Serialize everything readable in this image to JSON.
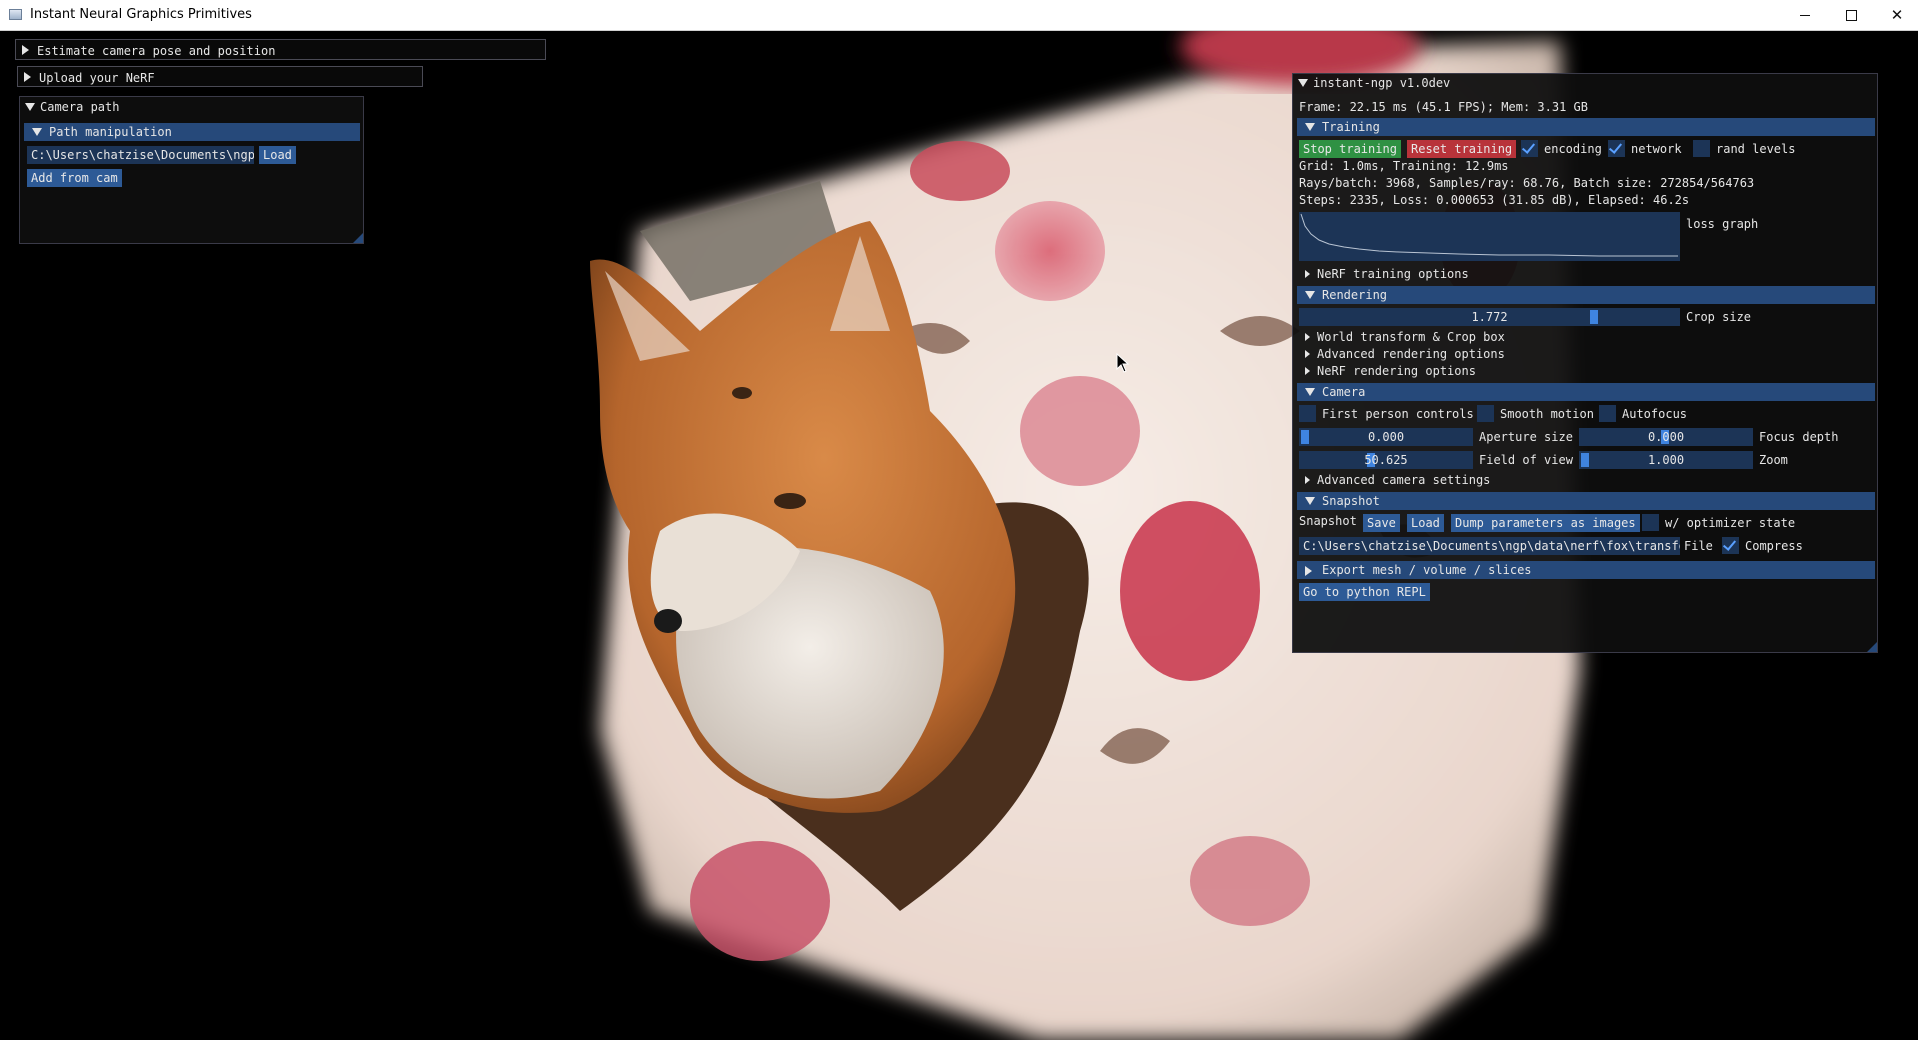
{
  "window": {
    "title": "Instant Neural Graphics Primitives",
    "controls": {
      "minimize": "–",
      "maximize": "□",
      "close": "✕"
    }
  },
  "left_windows": {
    "estimate": {
      "label": "Estimate camera pose and position"
    },
    "upload": {
      "label": "Upload your NeRF"
    },
    "camera_path": {
      "title": "Camera path",
      "path_manipulation": "Path manipulation",
      "path_value": "C:\\Users\\chatzise\\Documents\\ngp\\",
      "load_label": "Load",
      "add_from_cam_label": "Add from cam"
    }
  },
  "main_panel": {
    "title": "instant-ngp v1.0dev",
    "frame_info": "Frame: 22.15 ms (45.1 FPS); Mem: 3.31 GB",
    "training": {
      "header": "Training",
      "stop_label": "Stop training",
      "reset_label": "Reset training",
      "encoding_label": "encoding",
      "encoding_checked": true,
      "network_label": "network",
      "network_checked": true,
      "rand_levels_label": "rand levels",
      "rand_levels_checked": false,
      "grid_info": "Grid: 1.0ms, Training: 12.9ms",
      "rays_info": "Rays/batch: 3968, Samples/ray: 68.76, Batch size: 272854/564763",
      "steps_info": "Steps: 2335, Loss: 0.000653 (31.85 dB), Elapsed: 46.2s",
      "loss_graph_label": "loss graph",
      "options_label": "NeRF training options"
    },
    "rendering": {
      "header": "Rendering",
      "crop_value": "1.772",
      "crop_fraction": 0.77,
      "crop_label": "Crop size",
      "world_transform_label": "World transform & Crop box",
      "advanced_label": "Advanced rendering options",
      "nerf_label": "NeRF rendering options"
    },
    "camera": {
      "header": "Camera",
      "first_person_label": "First person controls",
      "smooth_motion_label": "Smooth motion",
      "autofocus_label": "Autofocus",
      "aperture_value": "0.000",
      "aperture_label": "Aperture size",
      "focus_value": "0.000",
      "focus_label": "Focus depth",
      "fov_value": "50.625",
      "fov_label": "Field of view",
      "zoom_value": "1.000",
      "zoom_label": "Zoom",
      "advanced_label": "Advanced camera settings"
    },
    "snapshot": {
      "header": "Snapshot",
      "label": "Snapshot",
      "save_label": "Save",
      "load_label": "Load",
      "dump_label": "Dump parameters as images",
      "optimizer_label": "w/ optimizer state",
      "optimizer_checked": false,
      "path_value": "C:\\Users\\chatzise\\Documents\\ngp\\data\\nerf\\fox\\transfor",
      "file_label": "File",
      "compress_label": "Compress",
      "compress_checked": true
    },
    "export": {
      "header": "Export mesh / volume / slices"
    },
    "python_repl_label": "Go to python REPL"
  },
  "colors": {
    "header_blue": "#26497a",
    "button_blue": "#2d5a96",
    "frame_blue": "#1c3456",
    "accent_blue": "#3f84e0",
    "stop_green": "#2f9143",
    "reset_red": "#b8333a"
  }
}
